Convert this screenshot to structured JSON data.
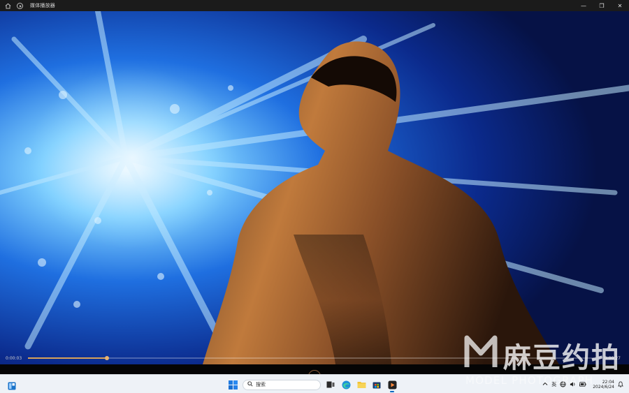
{
  "window": {
    "title": "媒体播放器",
    "controls": {
      "minimize": "—",
      "restore": "❐",
      "close": "✕"
    }
  },
  "player": {
    "current_time": "0:00:03",
    "total_time": "0:00:27",
    "progress_fraction": 0.14
  },
  "taskbar": {
    "search_placeholder": "搜索",
    "apps": [
      "start-icon",
      "search-icon",
      "task-view-icon",
      "edge-icon",
      "file-explorer-icon",
      "store-icon",
      "media-player-icon"
    ],
    "tray": {
      "ime": "英",
      "time": "22:04",
      "date": "2024/6/24"
    }
  },
  "watermark": {
    "text": "麻豆约拍",
    "subtext": "MODEL PHOTOGRAPH"
  },
  "colors": {
    "accent": "#0067c0",
    "progress": "#d8a25a",
    "titlebar": "#1b1b1b",
    "taskbar": "#eef2f7"
  }
}
